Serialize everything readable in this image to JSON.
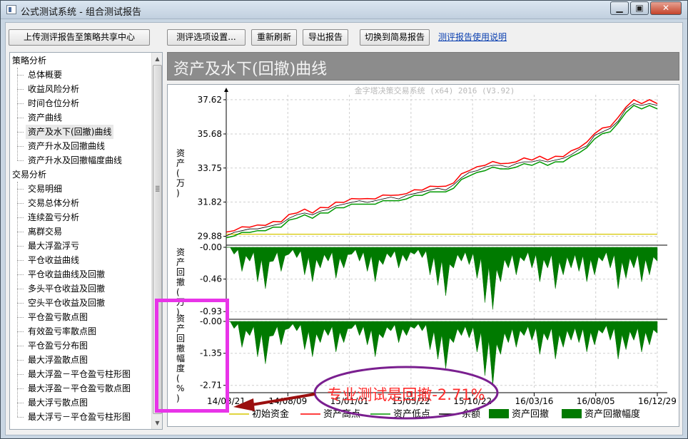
{
  "window": {
    "title": "公式测试系统 - 组合测试报告",
    "controls": [
      "▁",
      "▣",
      "✕"
    ]
  },
  "toolbar": {
    "upload_label": "上传测评报告至策略共享中心",
    "options_label": "测评选项设置...",
    "refresh_label": "重新刷新",
    "export_label": "导出报告",
    "simple_label": "切换到简易报告",
    "help_link": "测评报告使用说明"
  },
  "tree": {
    "groups": [
      {
        "label": "策略分析",
        "items": [
          "总体概要",
          "收益风险分析",
          "时间仓位分析",
          "资产曲线",
          "资产及水下(回撤)曲线",
          "资产升水及回撤曲线",
          "资产升水及回撤幅度曲线"
        ]
      },
      {
        "label": "交易分析",
        "items": [
          "交易明细",
          "交易总体分析",
          "连续盈亏分析",
          "离群交易",
          "最大浮盈浮亏",
          "平仓收益曲线",
          "平仓收益曲线及回撤",
          "多头平仓收益及回撤",
          "空头平仓收益及回撤",
          "平仓盈亏散点图",
          "有效盈亏率散点图",
          "平仓盈亏分布图",
          "最大浮盈散点图",
          "最大浮盈－平仓盈亏柱形图",
          "最大浮盈－平仓盈亏散点图",
          "最大浮亏散点图",
          "最大浮亏－平仓盈亏柱形图"
        ]
      }
    ],
    "selected": "资产及水下(回撤)曲线"
  },
  "chart_header": {
    "title": "资产及水下(回撤)曲线"
  },
  "chart_data": {
    "type": "line",
    "watermark": "金字塔决策交易系统 (x64) 2016 (V3.92)",
    "panels": [
      {
        "ylabel": "资产(万)",
        "yticks": [
          "37.62",
          "35.68",
          "33.75",
          "31.82",
          "29.88"
        ],
        "ylim": [
          29.5,
          37.9
        ],
        "series": [
          {
            "name": "初始资金",
            "color": "#d6c700",
            "value": 30.0
          },
          {
            "name": "资产高点",
            "color": "#ff0000"
          },
          {
            "name": "资产低点",
            "color": "#009900"
          },
          {
            "name": "余额",
            "color": "#000000"
          }
        ],
        "asset_curve": [
          29.9,
          30.1,
          30.2,
          30.3,
          30.3,
          30.4,
          30.5,
          30.6,
          30.9,
          31.1,
          31.2,
          31.1,
          31.3,
          31.4,
          31.6,
          31.7,
          31.8,
          31.9,
          31.8,
          31.9,
          32.0,
          32.1,
          32.0,
          32.2,
          32.3,
          32.4,
          32.5,
          32.6,
          32.5,
          32.8,
          33.2,
          33.5,
          33.6,
          33.8,
          33.9,
          33.9,
          33.8,
          34.0,
          34.1,
          34.1,
          34.2,
          34.1,
          34.2,
          34.3,
          34.5,
          34.8,
          35.0,
          35.6,
          35.8,
          36.0,
          36.4,
          37.1,
          37.4,
          37.3,
          37.4,
          37.3
        ]
      },
      {
        "ylabel": "资产回撤(万)",
        "yticks": [
          "-0.00",
          "-0.46",
          "-0.93"
        ],
        "ylim": [
          -1.0,
          0.0
        ],
        "series": [
          {
            "name": "资产回撤",
            "color": "#007a00"
          }
        ],
        "drawdown": [
          0.0,
          -0.1,
          -0.35,
          -0.2,
          -0.5,
          -0.6,
          -0.2,
          -0.35,
          -0.1,
          -0.15,
          -0.4,
          -0.5,
          -0.3,
          -0.2,
          -0.45,
          -0.3,
          -0.1,
          -0.2,
          -0.35,
          -0.5,
          -0.25,
          -0.15,
          -0.3,
          -0.2,
          -0.1,
          -0.15,
          -0.4,
          -0.55,
          -0.7,
          -0.3,
          -0.2,
          -0.25,
          -0.45,
          -0.8,
          -0.9,
          -0.5,
          -0.3,
          -0.4,
          -0.2,
          -0.3,
          -0.5,
          -0.3,
          -0.6,
          -0.4,
          -0.3,
          -0.35,
          -0.5,
          -0.4,
          -0.2,
          -0.3,
          -0.6,
          -0.45,
          -0.3,
          -0.5,
          -0.4,
          -0.2
        ]
      },
      {
        "ylabel": "资产回撤幅度(%)",
        "yticks": [
          "-0.00",
          "-1.35",
          "-2.71"
        ],
        "ylim": [
          -2.9,
          0.0
        ],
        "series": [
          {
            "name": "资产回撤幅度",
            "color": "#007a00"
          }
        ],
        "drawdown_pct": [
          0.0,
          -0.3,
          -1.1,
          -0.6,
          -1.5,
          -1.8,
          -0.6,
          -1.0,
          -0.3,
          -0.4,
          -1.2,
          -1.5,
          -0.9,
          -0.6,
          -1.3,
          -0.9,
          -0.3,
          -0.6,
          -1.0,
          -1.5,
          -0.7,
          -0.4,
          -0.9,
          -0.6,
          -0.3,
          -0.4,
          -1.2,
          -1.6,
          -2.0,
          -0.9,
          -0.6,
          -0.7,
          -1.3,
          -2.3,
          -2.71,
          -1.4,
          -0.9,
          -1.1,
          -0.6,
          -0.8,
          -1.4,
          -0.8,
          -1.6,
          -1.1,
          -0.8,
          -0.9,
          -1.3,
          -1.0,
          -0.5,
          -0.8,
          -1.6,
          -1.2,
          -0.8,
          -1.3,
          -1.0,
          -0.5
        ]
      }
    ],
    "xticks": [
      "14/03/21",
      "14/08/09",
      "15/01/01",
      "15/05/22",
      "15/10/22",
      "16/03/16",
      "16/08/05",
      "16/12/29"
    ],
    "legend": [
      {
        "label": "初始资金",
        "kind": "line",
        "color": "#d6c700"
      },
      {
        "label": "资产高点",
        "kind": "line",
        "color": "#ff0000"
      },
      {
        "label": "资产低点",
        "kind": "line",
        "color": "#009900"
      },
      {
        "label": "余额",
        "kind": "line",
        "color": "#000000"
      },
      {
        "label": "资产回撤",
        "kind": "box",
        "color": "#007a00"
      },
      {
        "label": "资产回撤幅度",
        "kind": "box",
        "color": "#007a00"
      }
    ],
    "callout": "专业测试是回撤-2.71%"
  },
  "colors": {
    "highlight": "#e834e8",
    "callout_border": "#7a1f8f",
    "callout_text": "#ff2a2a",
    "arrow": "#9b0f0f"
  }
}
